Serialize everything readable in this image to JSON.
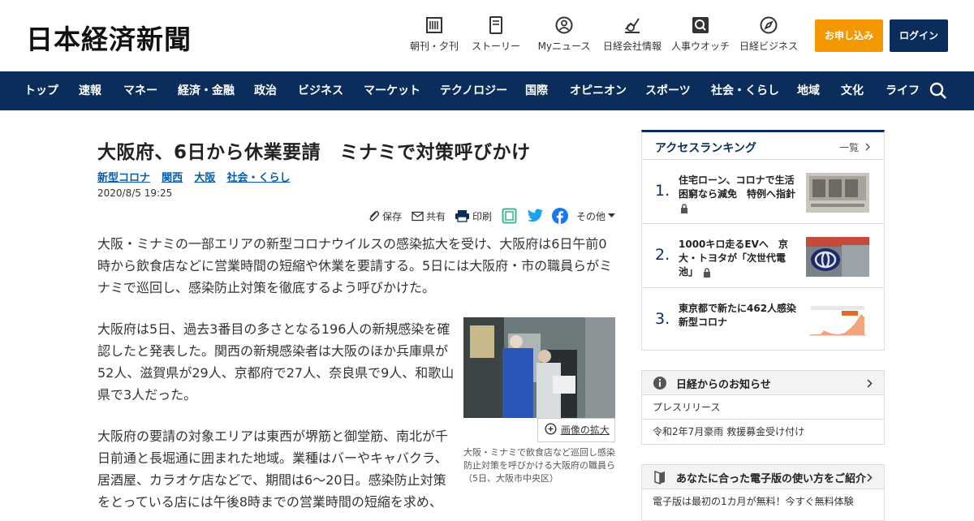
{
  "header": {
    "logo": "日本経済新聞",
    "tools": [
      {
        "label": "朝刊・夕刊",
        "icon": "newspaper-icon"
      },
      {
        "label": "ストーリー",
        "icon": "story-icon"
      },
      {
        "label": "Myニュース",
        "icon": "person-icon"
      },
      {
        "label": "日経会社情報",
        "icon": "chart-icon"
      },
      {
        "label": "人事ウオッチ",
        "icon": "magnifier-icon"
      },
      {
        "label": "日経ビジネス",
        "icon": "compass-icon"
      }
    ],
    "apply_label": "お申し込み",
    "login_label": "ログイン"
  },
  "nav": {
    "items": [
      "トップ",
      "速報",
      "マネー",
      "経済・金融",
      "政治",
      "ビジネス",
      "マーケット",
      "テクノロジー",
      "国際",
      "オピニオン",
      "スポーツ",
      "社会・くらし",
      "地域",
      "文化",
      "ライフ"
    ]
  },
  "article": {
    "title": "大阪府、6日から休業要請　ミナミで対策呼びかけ",
    "tags": [
      "新型コロナ",
      "関西",
      "大阪",
      "社会・くらし"
    ],
    "date": "2020/8/5 19:25",
    "share": {
      "save": "保存",
      "share": "共有",
      "print": "印刷",
      "more": "その他"
    },
    "paragraphs": [
      "大阪・ミナミの一部エリアの新型コロナウイルスの感染拡大を受け、大阪府は6日午前0時から飲食店などに営業時間の短縮や休業を要請する。5日には大阪府・市の職員らがミナミで巡回し、感染防止対策を徹底するよう呼びかけた。",
      "大阪府は5日、過去3番目の多さとなる196人の新規感染を確認したと発表した。関西の新規感染者は大阪のほか兵庫県が52人、滋賀県が29人、京都府で27人、奈良県で9人、和歌山県で3人だった。",
      "大阪府の要請の対象エリアは東西が堺筋と御堂筋、南北が千日前通と長堀通に囲まれた地域。業種はバーやキャバクラ、居酒屋、カラオケ店などで、期間は6～20日。感染防止対策をとっている店には午後8時までの営業時間の短縮を求め、"
    ],
    "enlarge_label": "画像の拡大",
    "caption": "大阪・ミナミで飲食店など巡回し感染防止対策を呼びかける大阪府の職員ら（5日、大阪市中央区）"
  },
  "ranking": {
    "title": "アクセスランキング",
    "more": "一覧",
    "items": [
      {
        "num": "1.",
        "text": "住宅ローン、コロナで生活困窮なら減免　特例へ指針",
        "locked": true
      },
      {
        "num": "2.",
        "text": "1000キロ走るEVへ　京大・トヨタが「次世代電池」",
        "locked": true
      },
      {
        "num": "3.",
        "text": "東京都で新たに462人感染　新型コロナ",
        "locked": false
      }
    ]
  },
  "info": {
    "title": "日経からのお知らせ",
    "rows": [
      "プレスリリース",
      "令和2年7月豪雨 救援募金受け付け"
    ]
  },
  "guide": {
    "title": "あなたに合った電子版の使い方をご紹介",
    "row": "電子版は最初の1カ月が無料！今すぐ無料体験"
  },
  "colors": {
    "brand_navy": "#0a2d5c",
    "apply_orange": "#f39800",
    "link_blue": "#0a5ba8"
  }
}
